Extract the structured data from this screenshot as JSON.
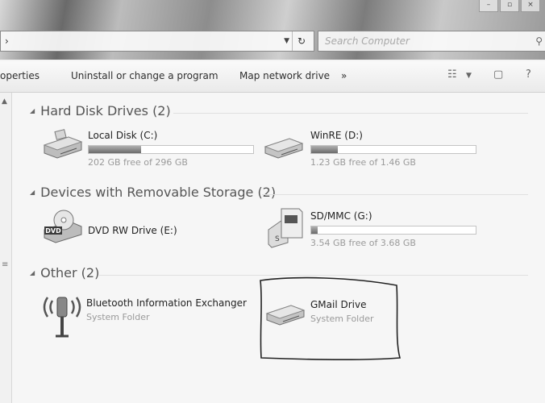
{
  "titlebar": {
    "address_crumb": "›",
    "search_placeholder": "Search Computer"
  },
  "toolbar": {
    "properties": "operties",
    "uninstall": "Uninstall or change a program",
    "map_drive": "Map network drive",
    "more": "»"
  },
  "groups": {
    "hard_disk": "Hard Disk Drives (2)",
    "removable": "Devices with Removable Storage (2)",
    "other": "Other (2)"
  },
  "items": {
    "local_disk": {
      "name": "Local Disk (C:)",
      "free": "202 GB free of 296 GB",
      "used_fraction": 0.32
    },
    "winre": {
      "name": "WinRE (D:)",
      "free": "1.23 GB free of 1.46 GB",
      "used_fraction": 0.16
    },
    "dvd": {
      "name": "DVD RW Drive (E:)",
      "icon_label": "DVD"
    },
    "sdmmc": {
      "name": "SD/MMC (G:)",
      "free": "3.54 GB free of 3.68 GB",
      "used_fraction": 0.04
    },
    "bluetooth": {
      "name": "Bluetooth Information Exchanger",
      "type": "System Folder"
    },
    "gmail": {
      "name": "GMail Drive",
      "type": "System Folder"
    }
  }
}
